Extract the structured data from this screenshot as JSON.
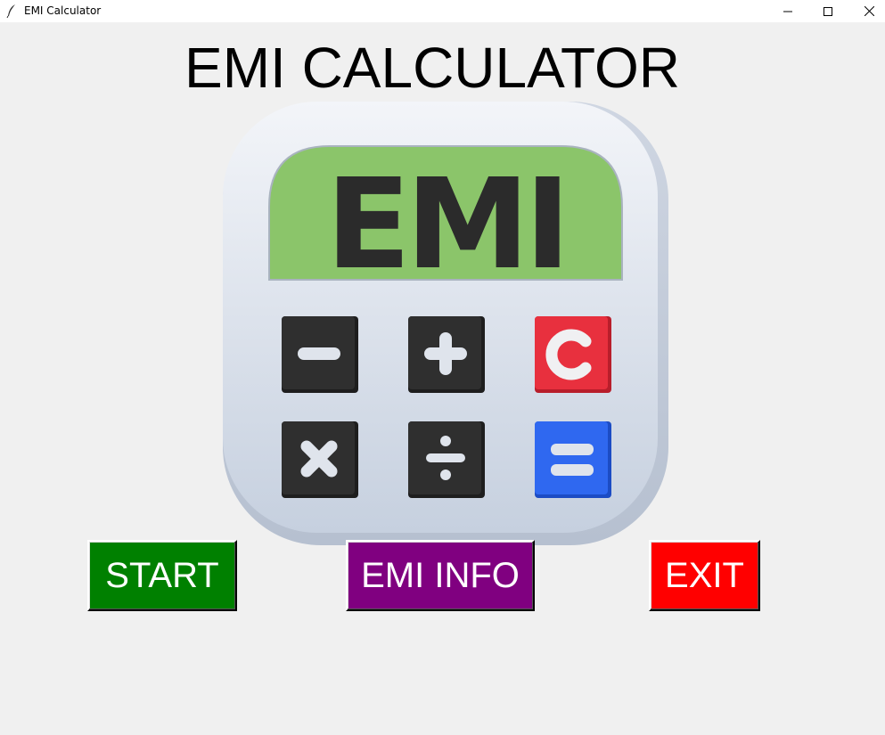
{
  "window": {
    "title": "EMI Calculator",
    "controls": [
      "minimize-icon",
      "maximize-icon",
      "close-icon"
    ]
  },
  "header": {
    "title": "EMI CALCULATOR"
  },
  "calculator_image": {
    "screen_text": "EMI",
    "keys": [
      "minus",
      "plus",
      "C",
      "multiply",
      "divide",
      "equals"
    ]
  },
  "buttons": {
    "start": {
      "label": "START",
      "color": "#008000"
    },
    "info": {
      "label": "EMI INFO",
      "color": "#800080"
    },
    "exit": {
      "label": "EXIT",
      "color": "#ff0000"
    }
  }
}
